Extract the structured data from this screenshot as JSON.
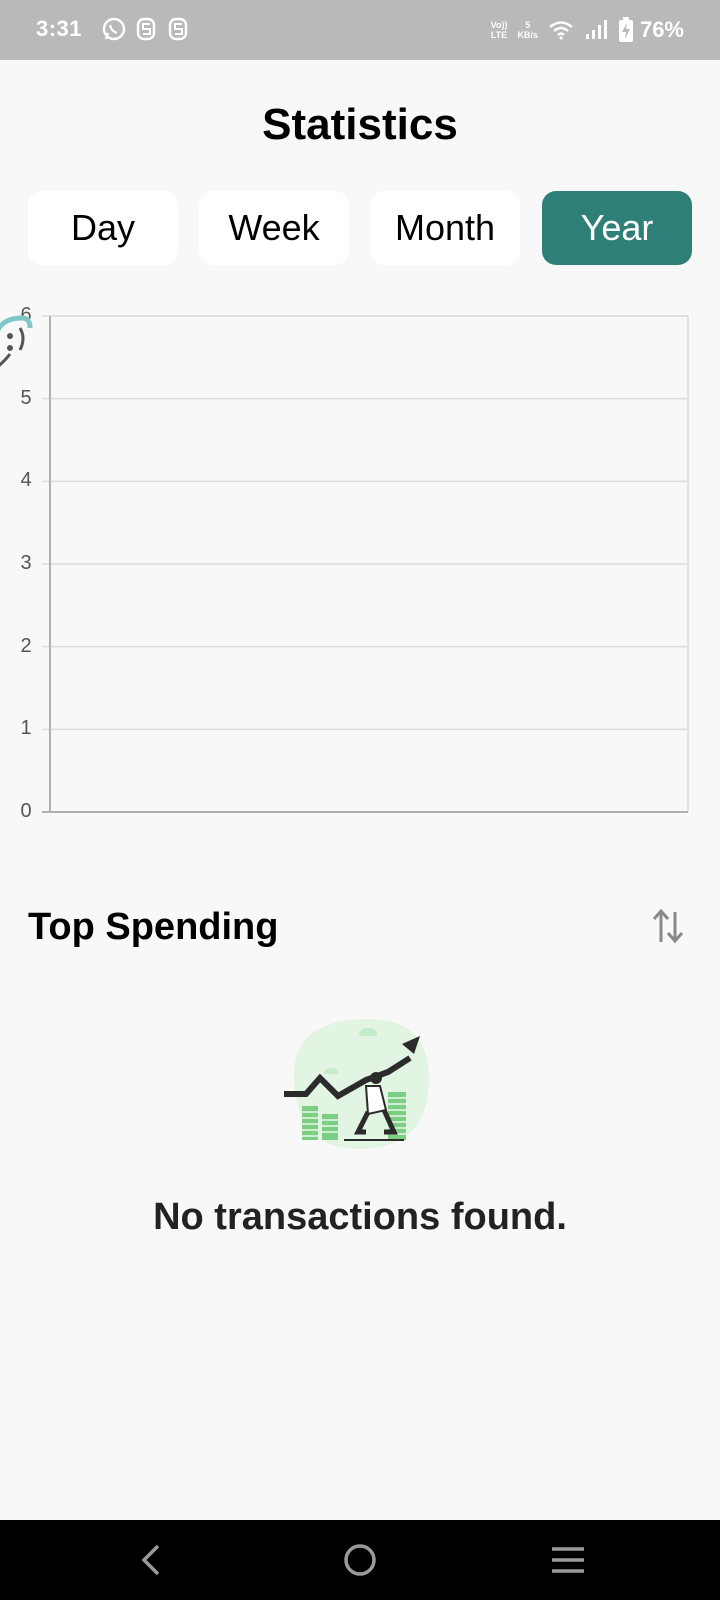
{
  "status_bar": {
    "time": "3:31",
    "battery": "76%",
    "network": {
      "volte_top": "Vo))",
      "volte_bottom": "LTE",
      "speed_value": "5",
      "speed_unit": "KB/s"
    },
    "icons": [
      "whatsapp-icon",
      "app-s-icon",
      "app-s-icon",
      "volte-icon",
      "data-speed-icon",
      "wifi-icon",
      "signal-icon",
      "battery-charging-icon"
    ]
  },
  "page_title": "Statistics",
  "tabs": [
    {
      "label": "Day",
      "active": false
    },
    {
      "label": "Week",
      "active": false
    },
    {
      "label": "Month",
      "active": false
    },
    {
      "label": "Year",
      "active": true
    }
  ],
  "chart_data": {
    "type": "line",
    "title": "",
    "xlabel": "",
    "ylabel": "",
    "ylim": [
      0,
      6
    ],
    "y_ticks": [
      "0",
      "1",
      "2",
      "3",
      "4",
      "5",
      "6"
    ],
    "series": [],
    "grid": "horizontal"
  },
  "section": {
    "title": "Top Spending",
    "sort_icon": "sort-arrows-icon"
  },
  "empty_state": {
    "illustration": "growth-chart-illustration",
    "message": "No transactions found."
  },
  "colors": {
    "accent": "#2f7f79",
    "background": "#f8f8f8",
    "status_bar": "#b9b9b9"
  },
  "nav": {
    "icons": [
      "back-icon",
      "home-icon",
      "recents-icon"
    ]
  }
}
